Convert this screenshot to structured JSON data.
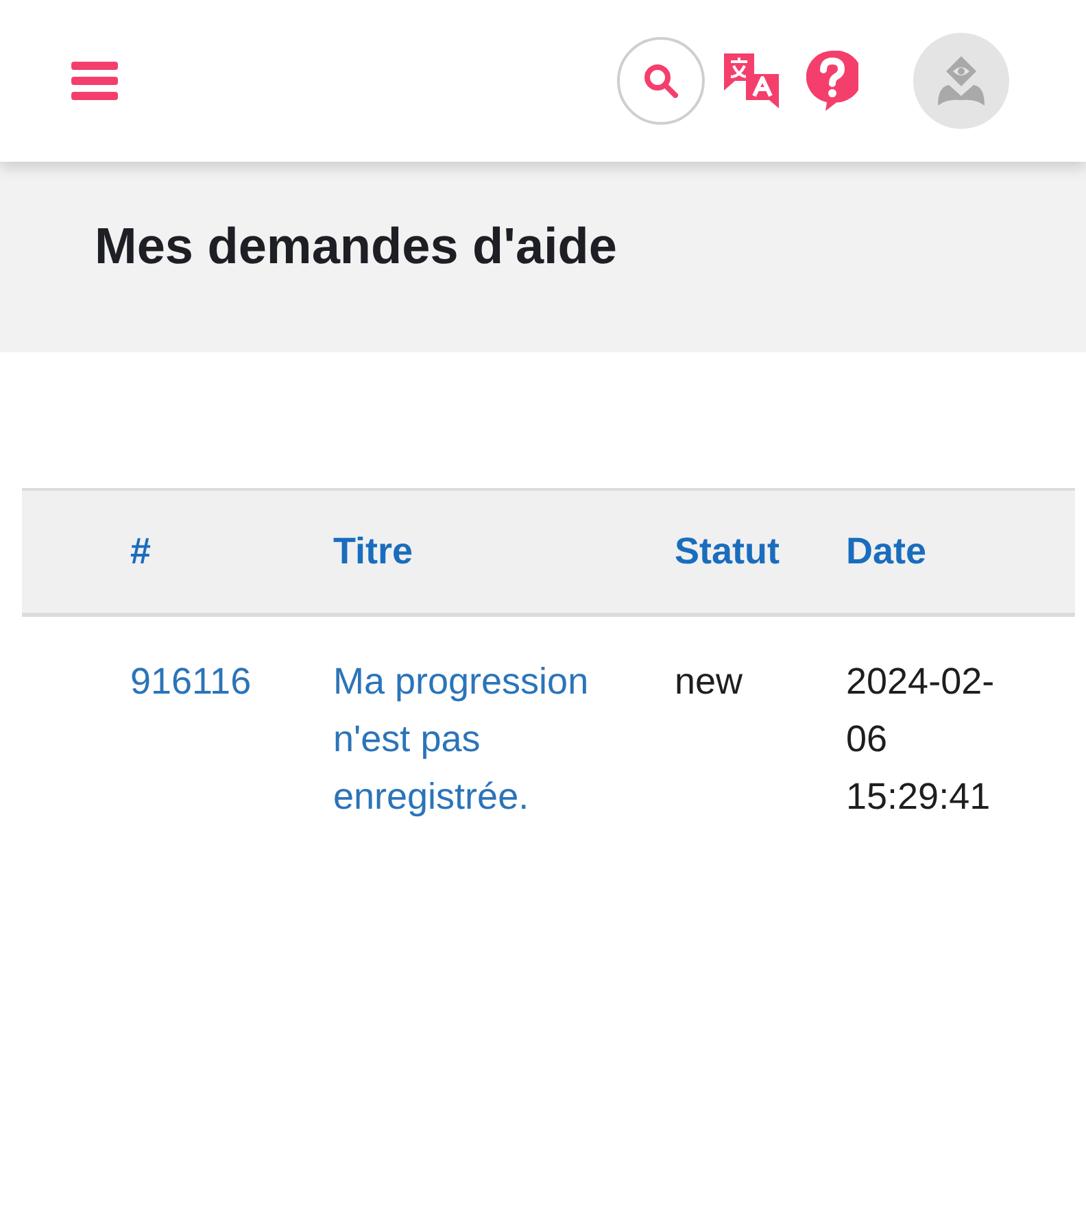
{
  "page": {
    "title": "Mes demandes d'aide"
  },
  "table": {
    "columns": [
      "#",
      "Titre",
      "Statut",
      "Date"
    ],
    "rows": [
      {
        "cells": [
          {
            "kind": "link",
            "text": "916116"
          },
          {
            "kind": "link",
            "text": "Ma progression n'est pas enregistrée."
          },
          {
            "kind": "text",
            "text": "new"
          },
          {
            "kind": "date",
            "text": "2024-02-06 15:29:41"
          }
        ]
      }
    ]
  }
}
